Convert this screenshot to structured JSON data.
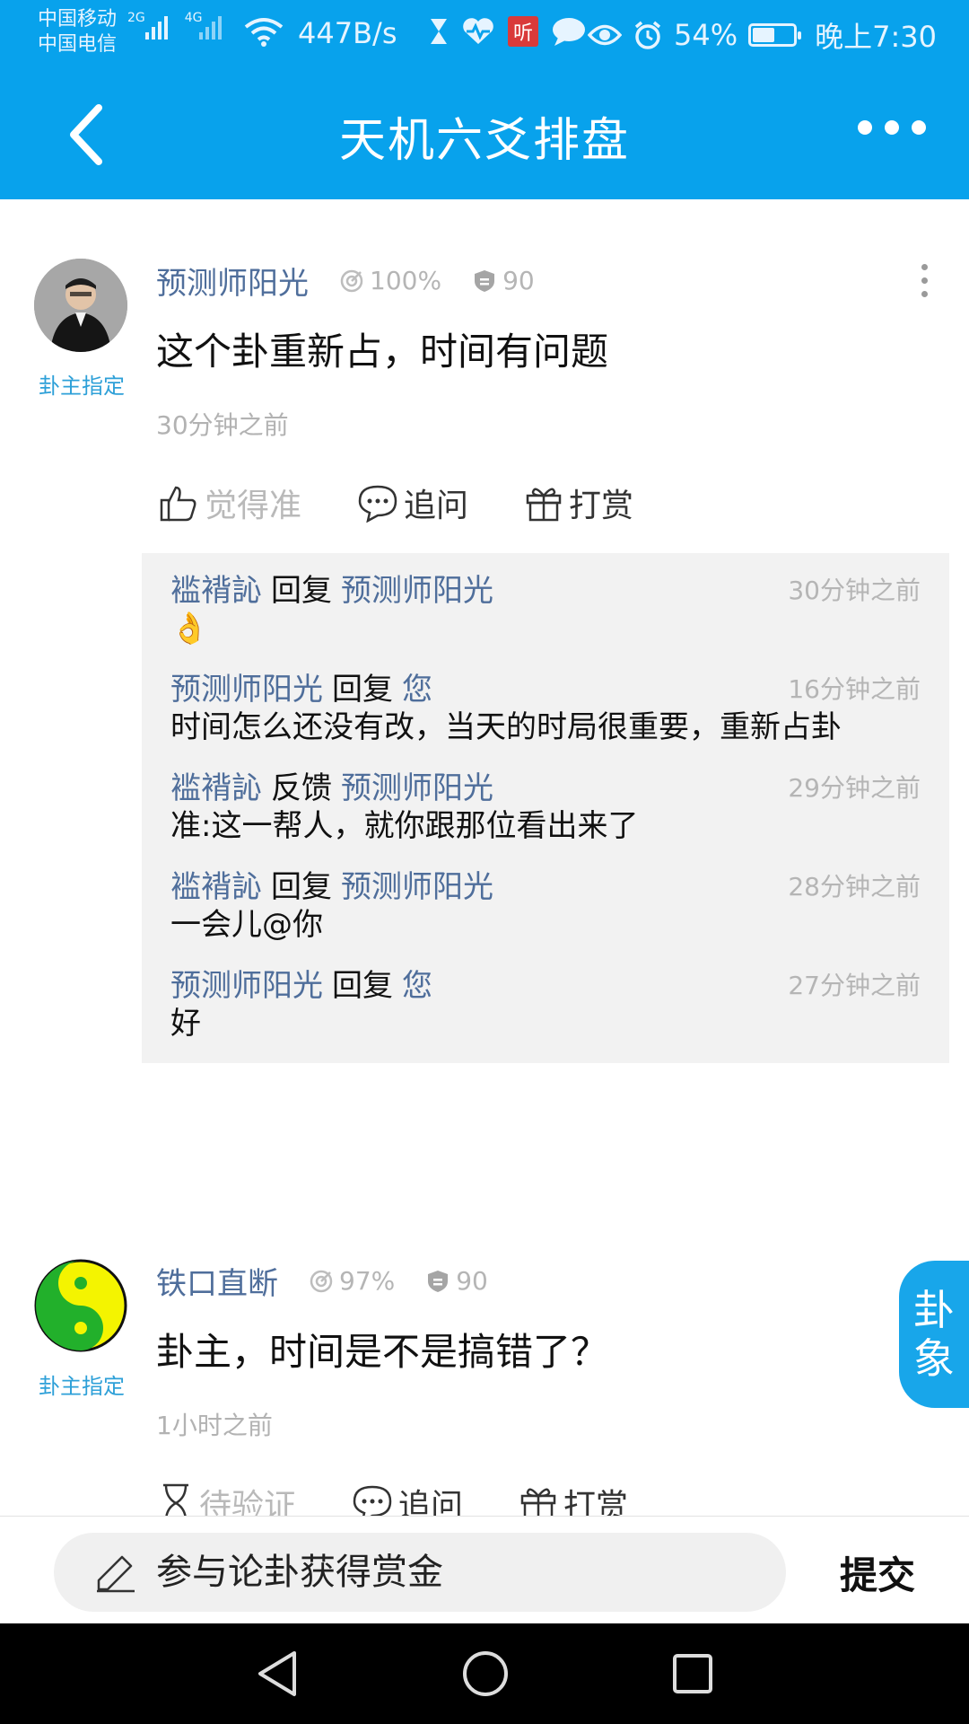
{
  "status_bar": {
    "carrier_1": "中国移动",
    "carrier_2": "中国电信",
    "net_1": "2G",
    "net_2": "4G",
    "speed": "447B/s",
    "ting_badge": "听",
    "battery_percent": "54%",
    "battery_level": 0.54,
    "time": "晚上7:30"
  },
  "nav": {
    "title": "天机六爻排盘"
  },
  "posts": [
    {
      "author": "预测师阳光",
      "accuracy": "100%",
      "credit": "90",
      "tag": "卦主指定",
      "text": "这个卦重新占，时间有问题",
      "time": "30分钟之前",
      "actions": {
        "like": "觉得准",
        "ask": "追问",
        "reward": "打赏"
      },
      "replies": [
        {
          "from": "褴褙訫",
          "verb": "回复",
          "to": "预测师阳光",
          "time": "30分钟之前",
          "body": "👌"
        },
        {
          "from": "预测师阳光",
          "verb": "回复",
          "to": "您",
          "time": "16分钟之前",
          "body": "时间怎么还没有改，当天的时局很重要，重新占卦"
        },
        {
          "from": "褴褙訫",
          "verb": "反馈",
          "to": "预测师阳光",
          "time": "29分钟之前",
          "body": "准:这一帮人，就你跟那位看出来了"
        },
        {
          "from": "褴褙訫",
          "verb": "回复",
          "to": "预测师阳光",
          "time": "28分钟之前",
          "body": "一会儿@你"
        },
        {
          "from": "预测师阳光",
          "verb": "回复",
          "to": "您",
          "time": "27分钟之前",
          "body": "好"
        }
      ]
    },
    {
      "author": "铁口直断",
      "accuracy": "97%",
      "credit": "90",
      "tag": "卦主指定",
      "text": "卦主，时间是不是搞错了？",
      "time": "1小时之前",
      "actions": {
        "like": "待验证",
        "ask": "追问",
        "reward": "打赏"
      }
    }
  ],
  "side_button": {
    "line1": "卦",
    "line2": "象"
  },
  "input_bar": {
    "placeholder": "参与论卦获得赏金",
    "submit_label": "提交"
  },
  "colors": {
    "brand_blue": "#08a2ec",
    "name_blue": "#4f6e9b",
    "tag_blue": "#2ea0d8"
  }
}
